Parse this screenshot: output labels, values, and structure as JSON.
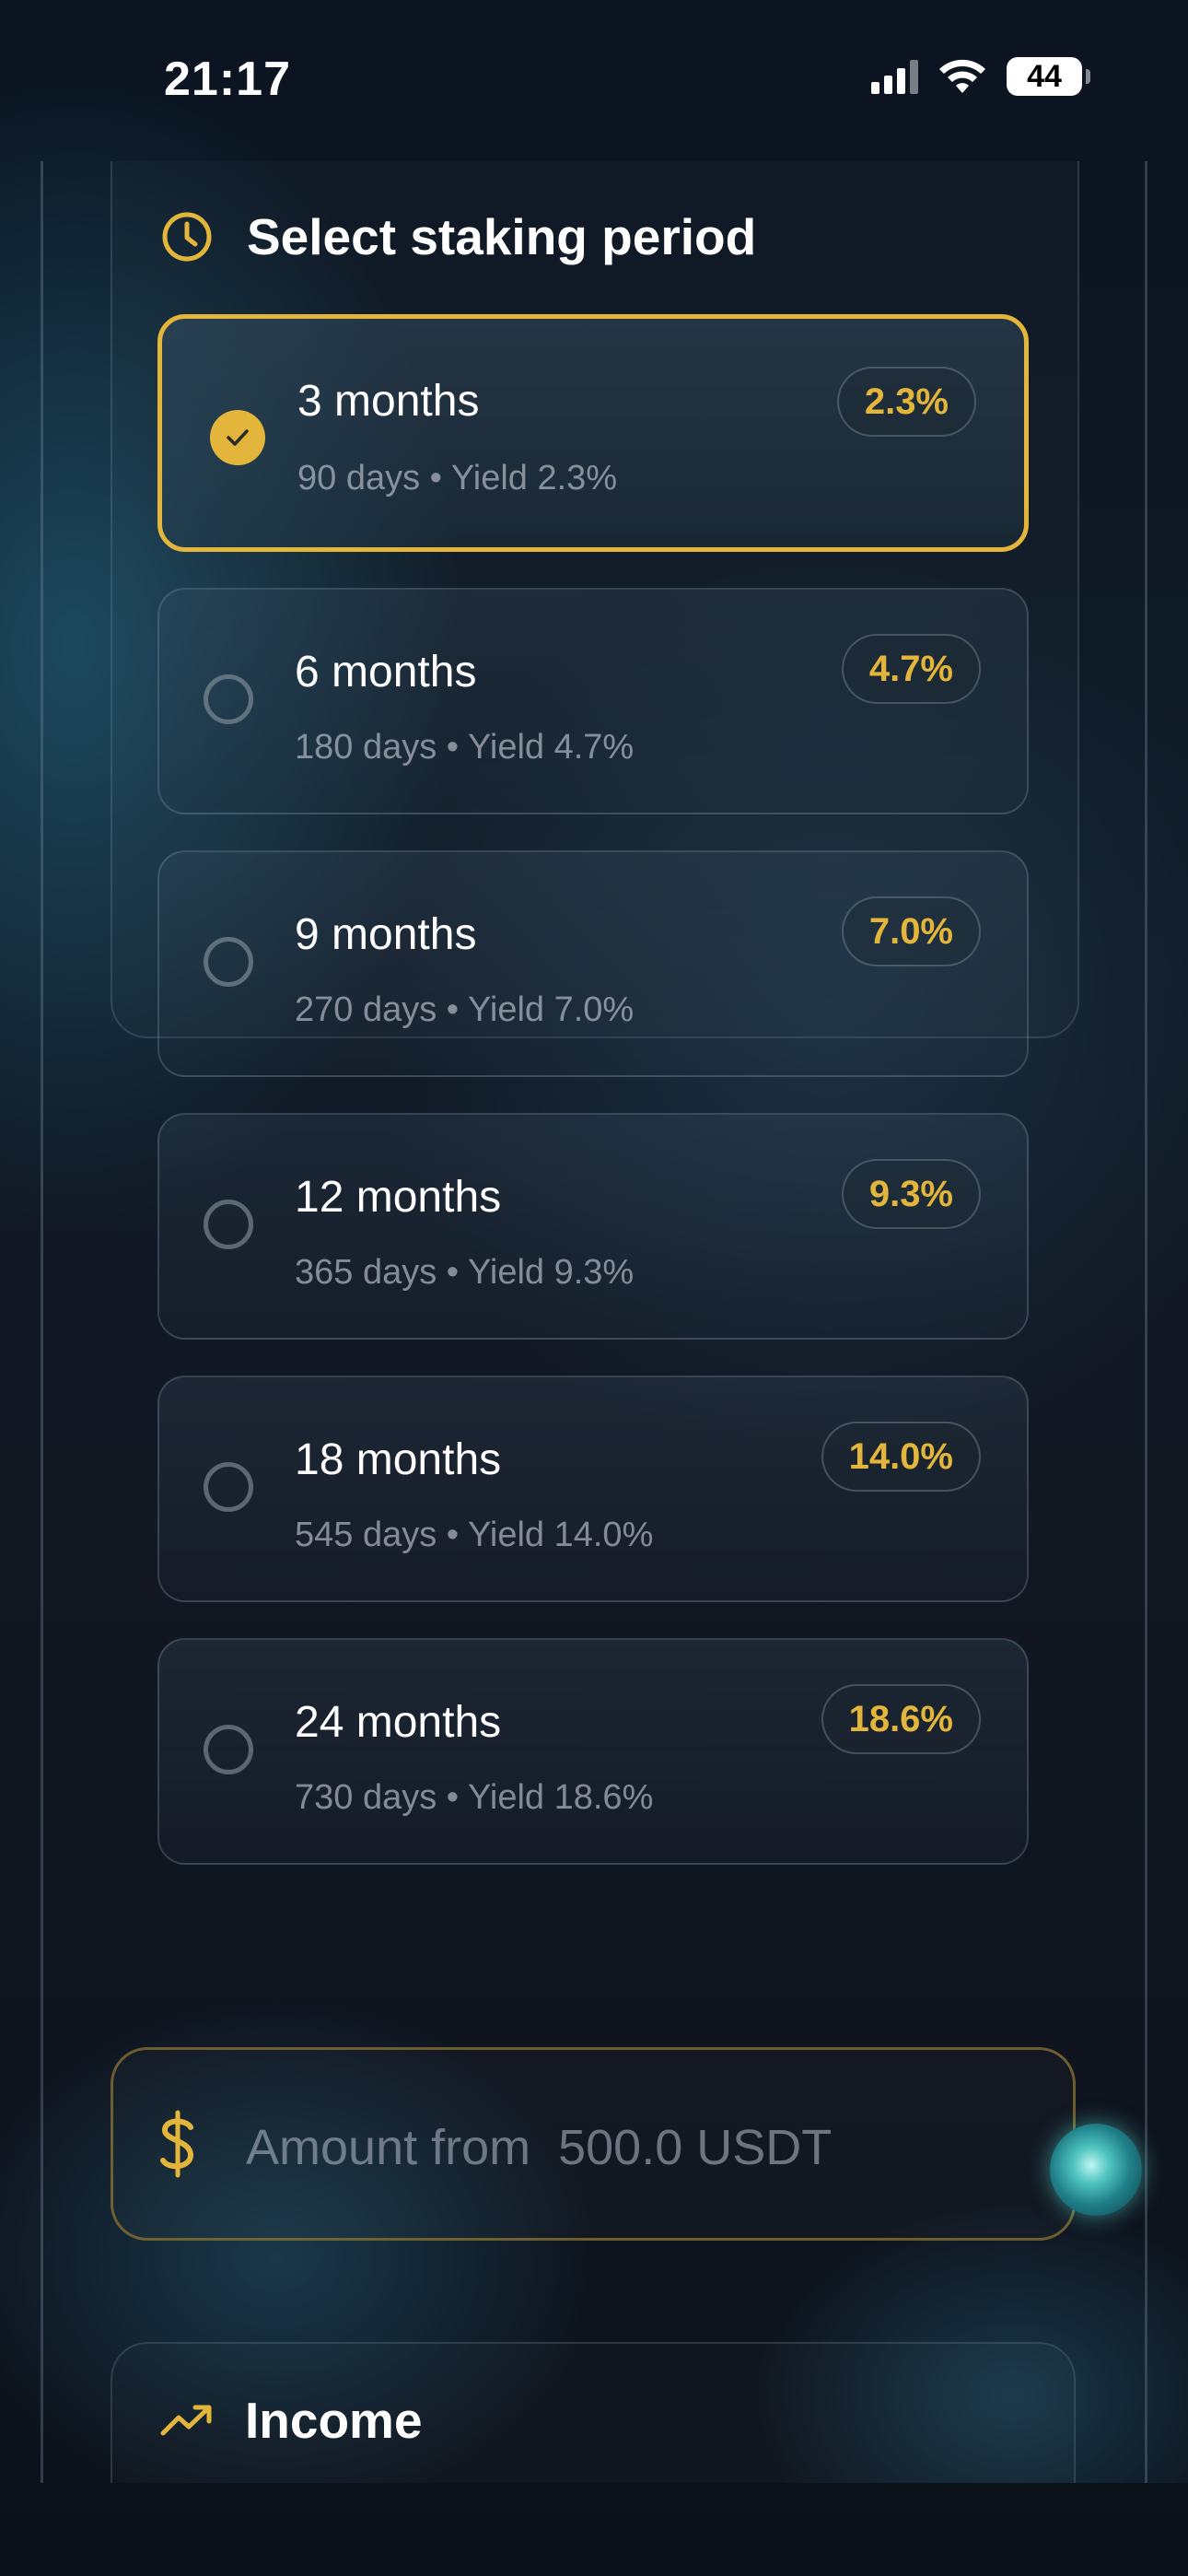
{
  "status_bar": {
    "time": "21:17",
    "battery": "44"
  },
  "staking": {
    "title": "Select staking period",
    "icon": "clock-icon",
    "options": [
      {
        "label": "3 months",
        "subtitle": "90 days • Yield 2.3%",
        "badge": "2.3%",
        "selected": true
      },
      {
        "label": "6 months",
        "subtitle": "180 days • Yield 4.7%",
        "badge": "4.7%",
        "selected": false
      },
      {
        "label": "9 months",
        "subtitle": "270 days • Yield 7.0%",
        "badge": "7.0%",
        "selected": false
      },
      {
        "label": "12 months",
        "subtitle": "365 days • Yield 9.3%",
        "badge": "9.3%",
        "selected": false
      },
      {
        "label": "18 months",
        "subtitle": "545 days • Yield 14.0%",
        "badge": "14.0%",
        "selected": false
      },
      {
        "label": "24 months",
        "subtitle": "730 days • Yield 18.6%",
        "badge": "18.6%",
        "selected": false
      }
    ]
  },
  "amount": {
    "placeholder": "Amount from  500.0 USDT",
    "value": "",
    "icon": "dollar-icon"
  },
  "income": {
    "title": "Income",
    "icon": "trend-up-icon"
  },
  "colors": {
    "accent": "#e3b53a",
    "background": "#0f1b27",
    "text": "#ffffff",
    "muted_text": "#a9adb6"
  }
}
